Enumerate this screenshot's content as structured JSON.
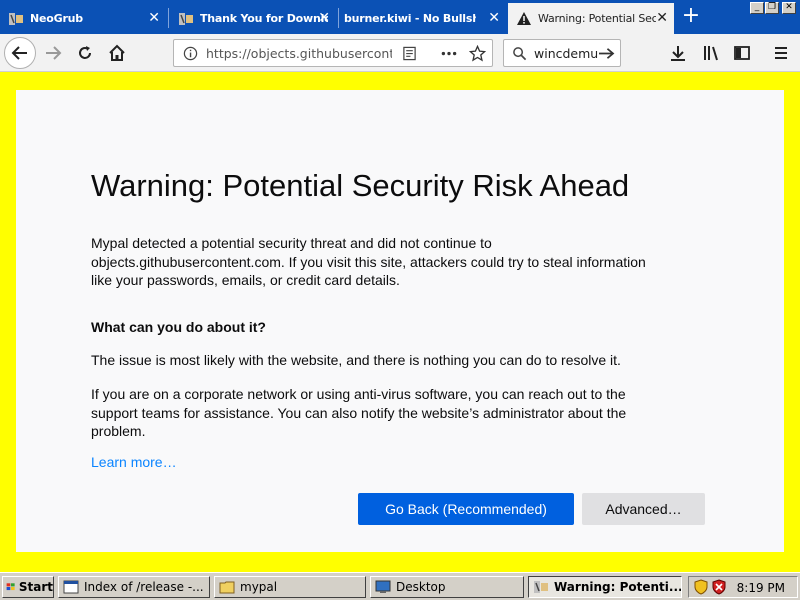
{
  "tabs": [
    {
      "title": "NeoGrub",
      "close": "✕"
    },
    {
      "title": "Thank You for Downloading",
      "close": "✕"
    },
    {
      "title": "burner.kiwi - No Bullshit Temp",
      "close": "✕"
    },
    {
      "title": "Warning: Potential Security Risk Ahead",
      "close": "✕"
    }
  ],
  "new_tab": "+",
  "window_buttons": {
    "minimize": "_",
    "restore": "❐",
    "close": "✕"
  },
  "navbar": {
    "url": "https://objects.githubusercontent.com",
    "search_value": "wincdemu"
  },
  "page": {
    "title": "Warning: Potential Security Risk Ahead",
    "intro_line1": "Mypal detected a potential security threat and did not continue to",
    "intro_line2": "objects.githubusercontent.com. If you visit this site, attackers could try to steal information",
    "intro_line3": "like your passwords, emails, or credit card details.",
    "heading": "What can you do about it?",
    "para1": "The issue is most likely with the website, and there is nothing you can do to resolve it.",
    "para2_line1": "If you are on a corporate network or using anti-virus software, you can reach out to the",
    "para2_line2": "support teams for assistance. You can also notify the website’s administrator about the",
    "para2_line3": "problem.",
    "learn_more": "Learn more…",
    "go_back": "Go Back (Recommended)",
    "advanced": "Advanced…"
  },
  "taskbar": {
    "start": "Start",
    "tasks": [
      {
        "label": "Index of /release -..."
      },
      {
        "label": "mypal"
      },
      {
        "label": "Desktop"
      },
      {
        "label": "Warning: Potenti..."
      }
    ],
    "clock": "8:19 PM"
  },
  "colors": {
    "tabbar": "#0b51b5",
    "border_highlight": "#ffff00",
    "primary_button": "#0060df",
    "link": "#0a84ff"
  }
}
